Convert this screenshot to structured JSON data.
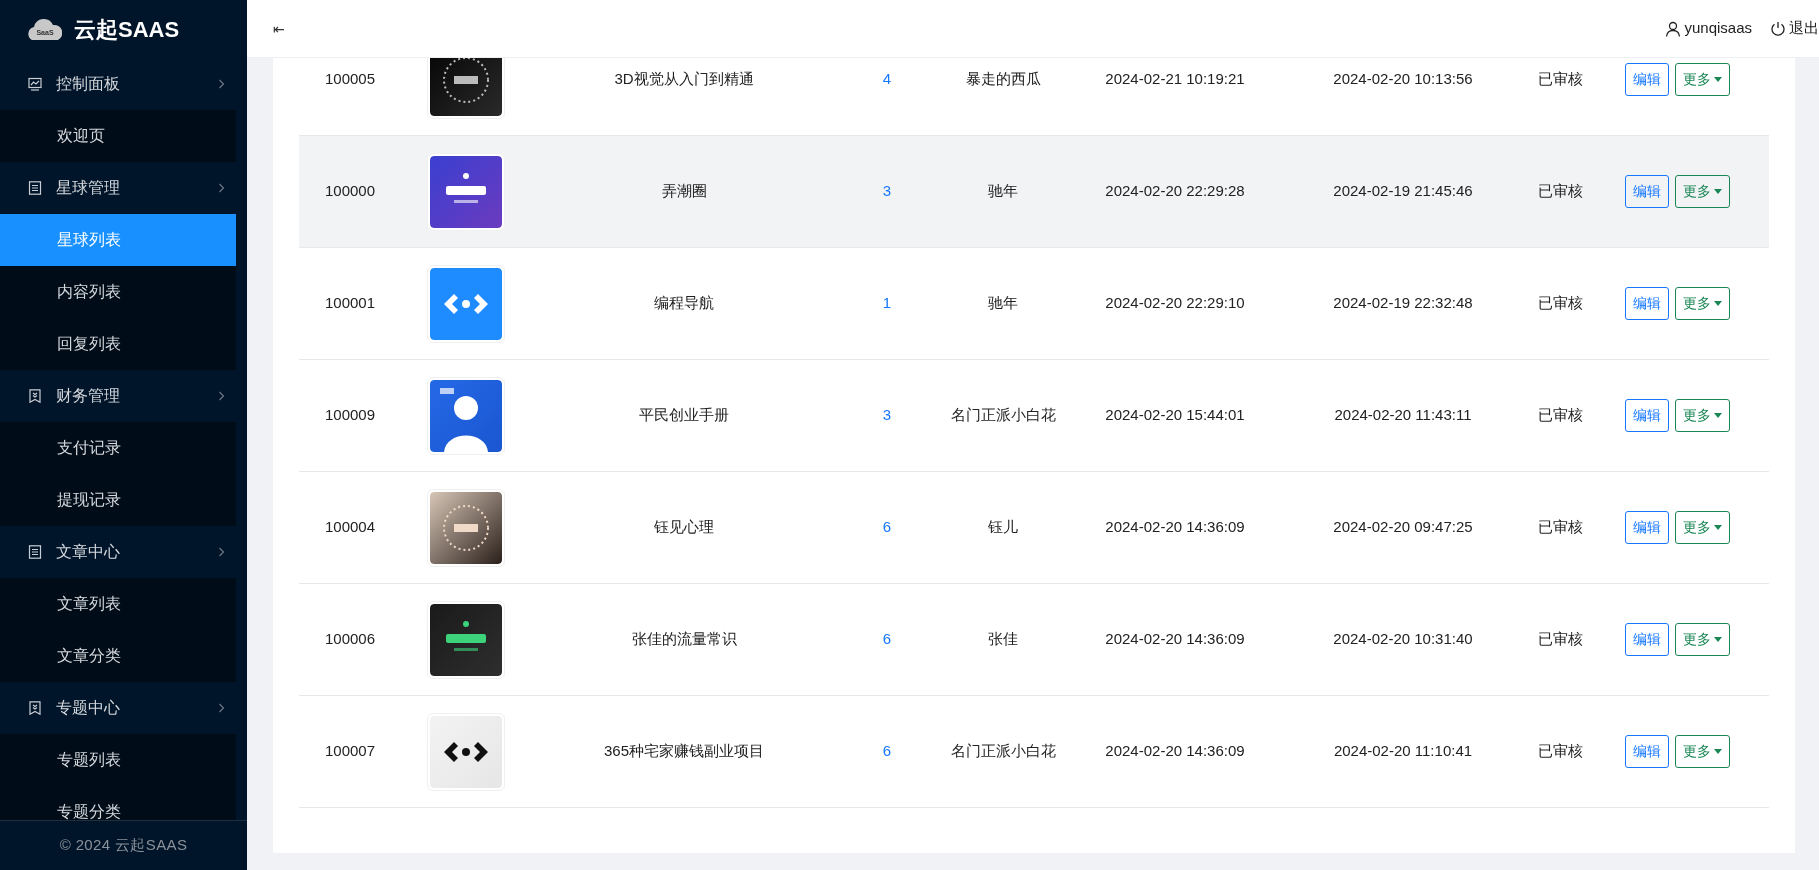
{
  "sidebar": {
    "logo_text": "SaaS",
    "brand": "云起SAAS",
    "menu": [
      {
        "label": "控制面板",
        "kind": "chart",
        "expanded": true,
        "children": [
          {
            "label": "欢迎页",
            "selected": false
          }
        ]
      },
      {
        "label": "星球管理",
        "kind": "list",
        "expanded": true,
        "children": [
          {
            "label": "星球列表",
            "selected": true
          },
          {
            "label": "内容列表",
            "selected": false
          },
          {
            "label": "回复列表",
            "selected": false
          }
        ]
      },
      {
        "label": "财务管理",
        "kind": "bookmark",
        "expanded": true,
        "children": [
          {
            "label": "支付记录",
            "selected": false
          },
          {
            "label": "提现记录",
            "selected": false
          }
        ]
      },
      {
        "label": "文章中心",
        "kind": "list",
        "expanded": true,
        "children": [
          {
            "label": "文章列表",
            "selected": false
          },
          {
            "label": "文章分类",
            "selected": false
          }
        ]
      },
      {
        "label": "专题中心",
        "kind": "bookmark",
        "expanded": true,
        "children": [
          {
            "label": "专题列表",
            "selected": false
          },
          {
            "label": "专题分类",
            "selected": false
          }
        ]
      }
    ],
    "footer": "© 2024 云起SAAS"
  },
  "header": {
    "collapse_icon": "⇤",
    "user": "yunqisaas",
    "logout": "退出"
  },
  "table": {
    "rows": [
      {
        "id": "100005",
        "name": "3D视觉从入门到精通",
        "count": "4",
        "author": "暴走的西瓜",
        "time_1": "2024-02-21 10:19:21",
        "time_2": "2024-02-20 10:13:56",
        "status": "已审核",
        "hovered": false,
        "actions": [
          "编辑",
          "更多"
        ]
      },
      {
        "id": "100000",
        "name": "弄潮圈",
        "count": "3",
        "author": "驰年",
        "time_1": "2024-02-20 22:29:28",
        "time_2": "2024-02-19 21:45:46",
        "status": "已审核",
        "hovered": true,
        "actions": [
          "编辑",
          "更多"
        ]
      },
      {
        "id": "100001",
        "name": "编程导航",
        "count": "1",
        "author": "驰年",
        "time_1": "2024-02-20 22:29:10",
        "time_2": "2024-02-19 22:32:48",
        "status": "已审核",
        "hovered": false,
        "actions": [
          "编辑",
          "更多"
        ]
      },
      {
        "id": "100009",
        "name": "平民创业手册",
        "count": "3",
        "author": "名门正派小白花",
        "time_1": "2024-02-20 15:44:01",
        "time_2": "2024-02-20 11:43:11",
        "status": "已审核",
        "hovered": false,
        "actions": [
          "编辑",
          "更多"
        ]
      },
      {
        "id": "100004",
        "name": "钰见心理",
        "count": "6",
        "author": "钰儿",
        "time_1": "2024-02-20 14:36:09",
        "time_2": "2024-02-20 09:47:25",
        "status": "已审核",
        "hovered": false,
        "actions": [
          "编辑",
          "更多"
        ]
      },
      {
        "id": "100006",
        "name": "张佳的流量常识",
        "count": "6",
        "author": "张佳",
        "time_1": "2024-02-20 14:36:09",
        "time_2": "2024-02-20 10:31:40",
        "status": "已审核",
        "hovered": false,
        "actions": [
          "编辑",
          "更多"
        ]
      },
      {
        "id": "100007",
        "name": "365种宅家赚钱副业项目",
        "count": "6",
        "author": "名门正派小白花",
        "time_1": "2024-02-20 14:36:09",
        "time_2": "2024-02-20 11:10:41",
        "status": "已审核",
        "hovered": false,
        "actions": [
          "编辑",
          "更多"
        ]
      }
    ]
  }
}
